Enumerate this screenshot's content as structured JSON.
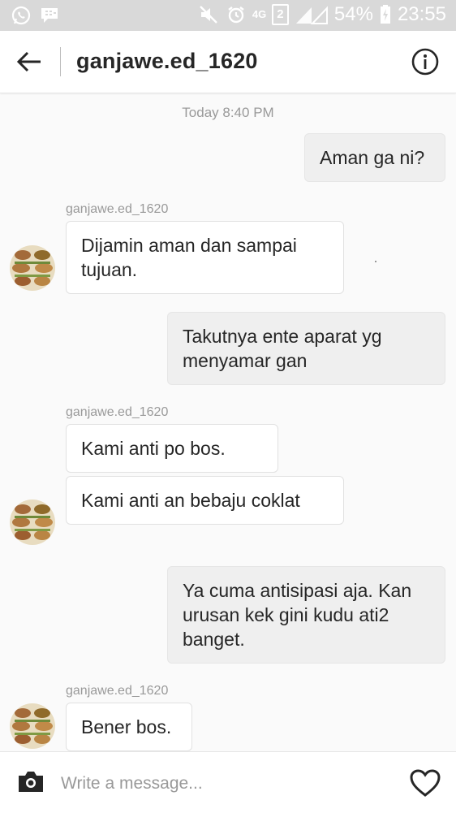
{
  "status_bar": {
    "left_icons": [
      "whatsapp-icon",
      "bbm-icon"
    ],
    "network": "4G",
    "sim_slot": "2",
    "battery": "54%",
    "time": "23:55"
  },
  "header": {
    "back_icon": "arrow-left-icon",
    "title": "ganjawe.ed_1620",
    "info_icon": "info-circle-icon"
  },
  "chat": {
    "timestamp": "Today 8:40 PM",
    "messages": [
      {
        "dir": "out",
        "text": "Aman ga ni?"
      },
      {
        "dir": "in",
        "sender": "ganjawe.ed_1620",
        "text": "Dijamin aman dan sampai tujuan."
      },
      {
        "dir": "out",
        "text": "Takutnya ente aparat yg menyamar gan"
      },
      {
        "dir": "in",
        "sender": "ganjawe.ed_1620",
        "text": "Kami anti po bos."
      },
      {
        "dir": "in",
        "text": "Kami anti an bebaju coklat"
      },
      {
        "dir": "out",
        "text": "Ya cuma antisipasi aja. Kan urusan kek gini kudu ati2 banget."
      },
      {
        "dir": "in",
        "sender": "ganjawe.ed_1620",
        "text": "Bener bos."
      }
    ]
  },
  "composer": {
    "camera_icon": "camera-icon",
    "placeholder": "Write a message...",
    "value": "",
    "heart_icon": "heart-icon"
  },
  "colors": {
    "status_bar_bg": "#d9d9d9",
    "incoming_bubble": "#ffffff",
    "outgoing_bubble": "#efefef",
    "meta_text": "#999999"
  }
}
